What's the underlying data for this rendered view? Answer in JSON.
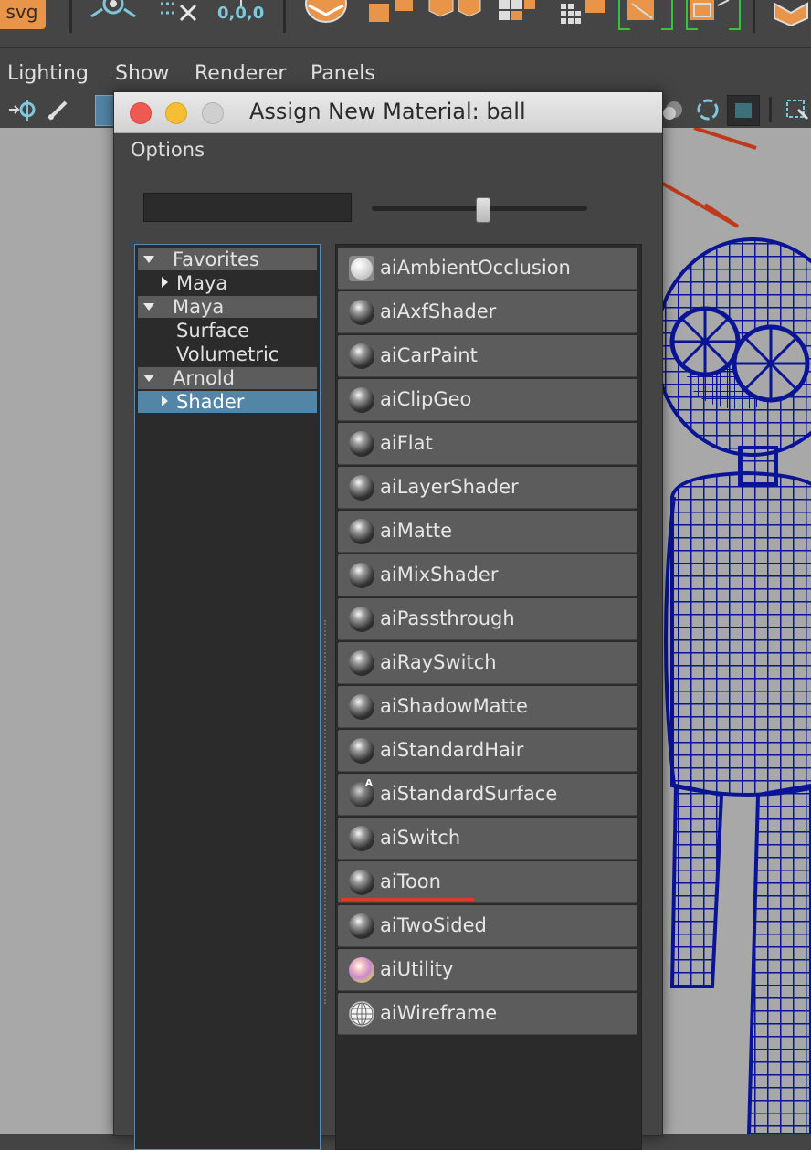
{
  "shelf": {
    "svg_label": "svg",
    "coord_label": "0,0,0"
  },
  "menubar": {
    "items": [
      "Lighting",
      "Show",
      "Renderer",
      "Panels"
    ]
  },
  "dialog": {
    "title": "Assign New Material: ball",
    "menu_options": "Options",
    "filter_value": "",
    "tree": {
      "favorites": "Favorites",
      "favorites_maya": "Maya",
      "maya": "Maya",
      "surface": "Surface",
      "volumetric": "Volumetric",
      "arnold": "Arnold",
      "shader": "Shader"
    },
    "shaders": [
      {
        "label": "aiAmbientOcclusion",
        "swatch": "white-sphere"
      },
      {
        "label": "aiAxfShader",
        "swatch": "dark-sphere"
      },
      {
        "label": "aiCarPaint",
        "swatch": "dark-sphere"
      },
      {
        "label": "aiClipGeo",
        "swatch": "dark-sphere"
      },
      {
        "label": "aiFlat",
        "swatch": "dark-sphere"
      },
      {
        "label": "aiLayerShader",
        "swatch": "dark-sphere"
      },
      {
        "label": "aiMatte",
        "swatch": "dark-sphere"
      },
      {
        "label": "aiMixShader",
        "swatch": "dark-sphere"
      },
      {
        "label": "aiPassthrough",
        "swatch": "dark-sphere"
      },
      {
        "label": "aiRaySwitch",
        "swatch": "dark-sphere"
      },
      {
        "label": "aiShadowMatte",
        "swatch": "dark-sphere"
      },
      {
        "label": "aiStandardHair",
        "swatch": "dark-sphere"
      },
      {
        "label": "aiStandardSurface",
        "swatch": "arnold-sphere"
      },
      {
        "label": "aiSwitch",
        "swatch": "dark-sphere"
      },
      {
        "label": "aiToon",
        "swatch": "dark-sphere"
      },
      {
        "label": "aiTwoSided",
        "swatch": "dark-sphere"
      },
      {
        "label": "aiUtility",
        "swatch": "rainbow-sphere"
      },
      {
        "label": "aiWireframe",
        "swatch": "wireframe-sphere"
      }
    ],
    "highlighted_shader": "aiToon",
    "highlight_color": "#e2382b"
  },
  "colors": {
    "accent_selection": "#5285a6",
    "wireframe": "#0a1496",
    "light_rig": "#c0391b"
  }
}
